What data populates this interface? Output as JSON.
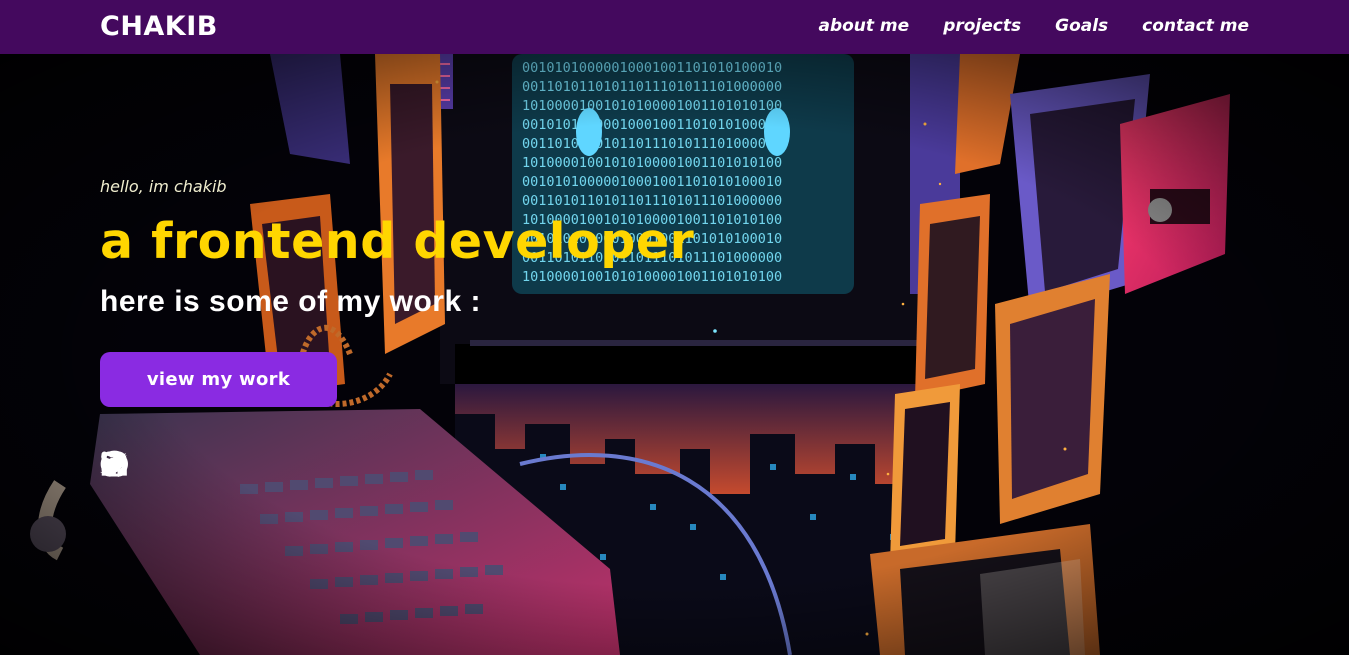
{
  "header": {
    "brand": "CHAKIB",
    "nav": [
      "about me",
      "projects",
      "Goals",
      "contact me"
    ]
  },
  "hero": {
    "greeting": "hello, im chakib",
    "headline": "a frontend developer",
    "subline": "here is some of my work :",
    "cta_label": "view my work",
    "background_art": "retro computer cityscape illustration with binary monitor",
    "monitor_binary": [
      "00101010000010001001101010100010",
      "00110101101011011101011101000000",
      "10100001001010100001001101010100",
      "00101010000010001001101010100010",
      "00110101101011011101011101000000",
      "10100001001010100001001101010100",
      "00101010000010001001101010100010",
      "00110101101011011101011101000000",
      "10100001001010100001001101010100",
      "00101010000010001001101010100010",
      "00110101101011011101011101000000",
      "10100001001010100001001101010100"
    ]
  },
  "socials": [
    {
      "name": "linkedin-icon"
    },
    {
      "name": "twitter-icon"
    },
    {
      "name": "instagram-icon"
    },
    {
      "name": "github-icon"
    }
  ],
  "colors": {
    "header_bg": "#44095e",
    "headline": "#ffd600",
    "cta_bg": "#8a2be2",
    "greeting": "#f0eecf"
  }
}
